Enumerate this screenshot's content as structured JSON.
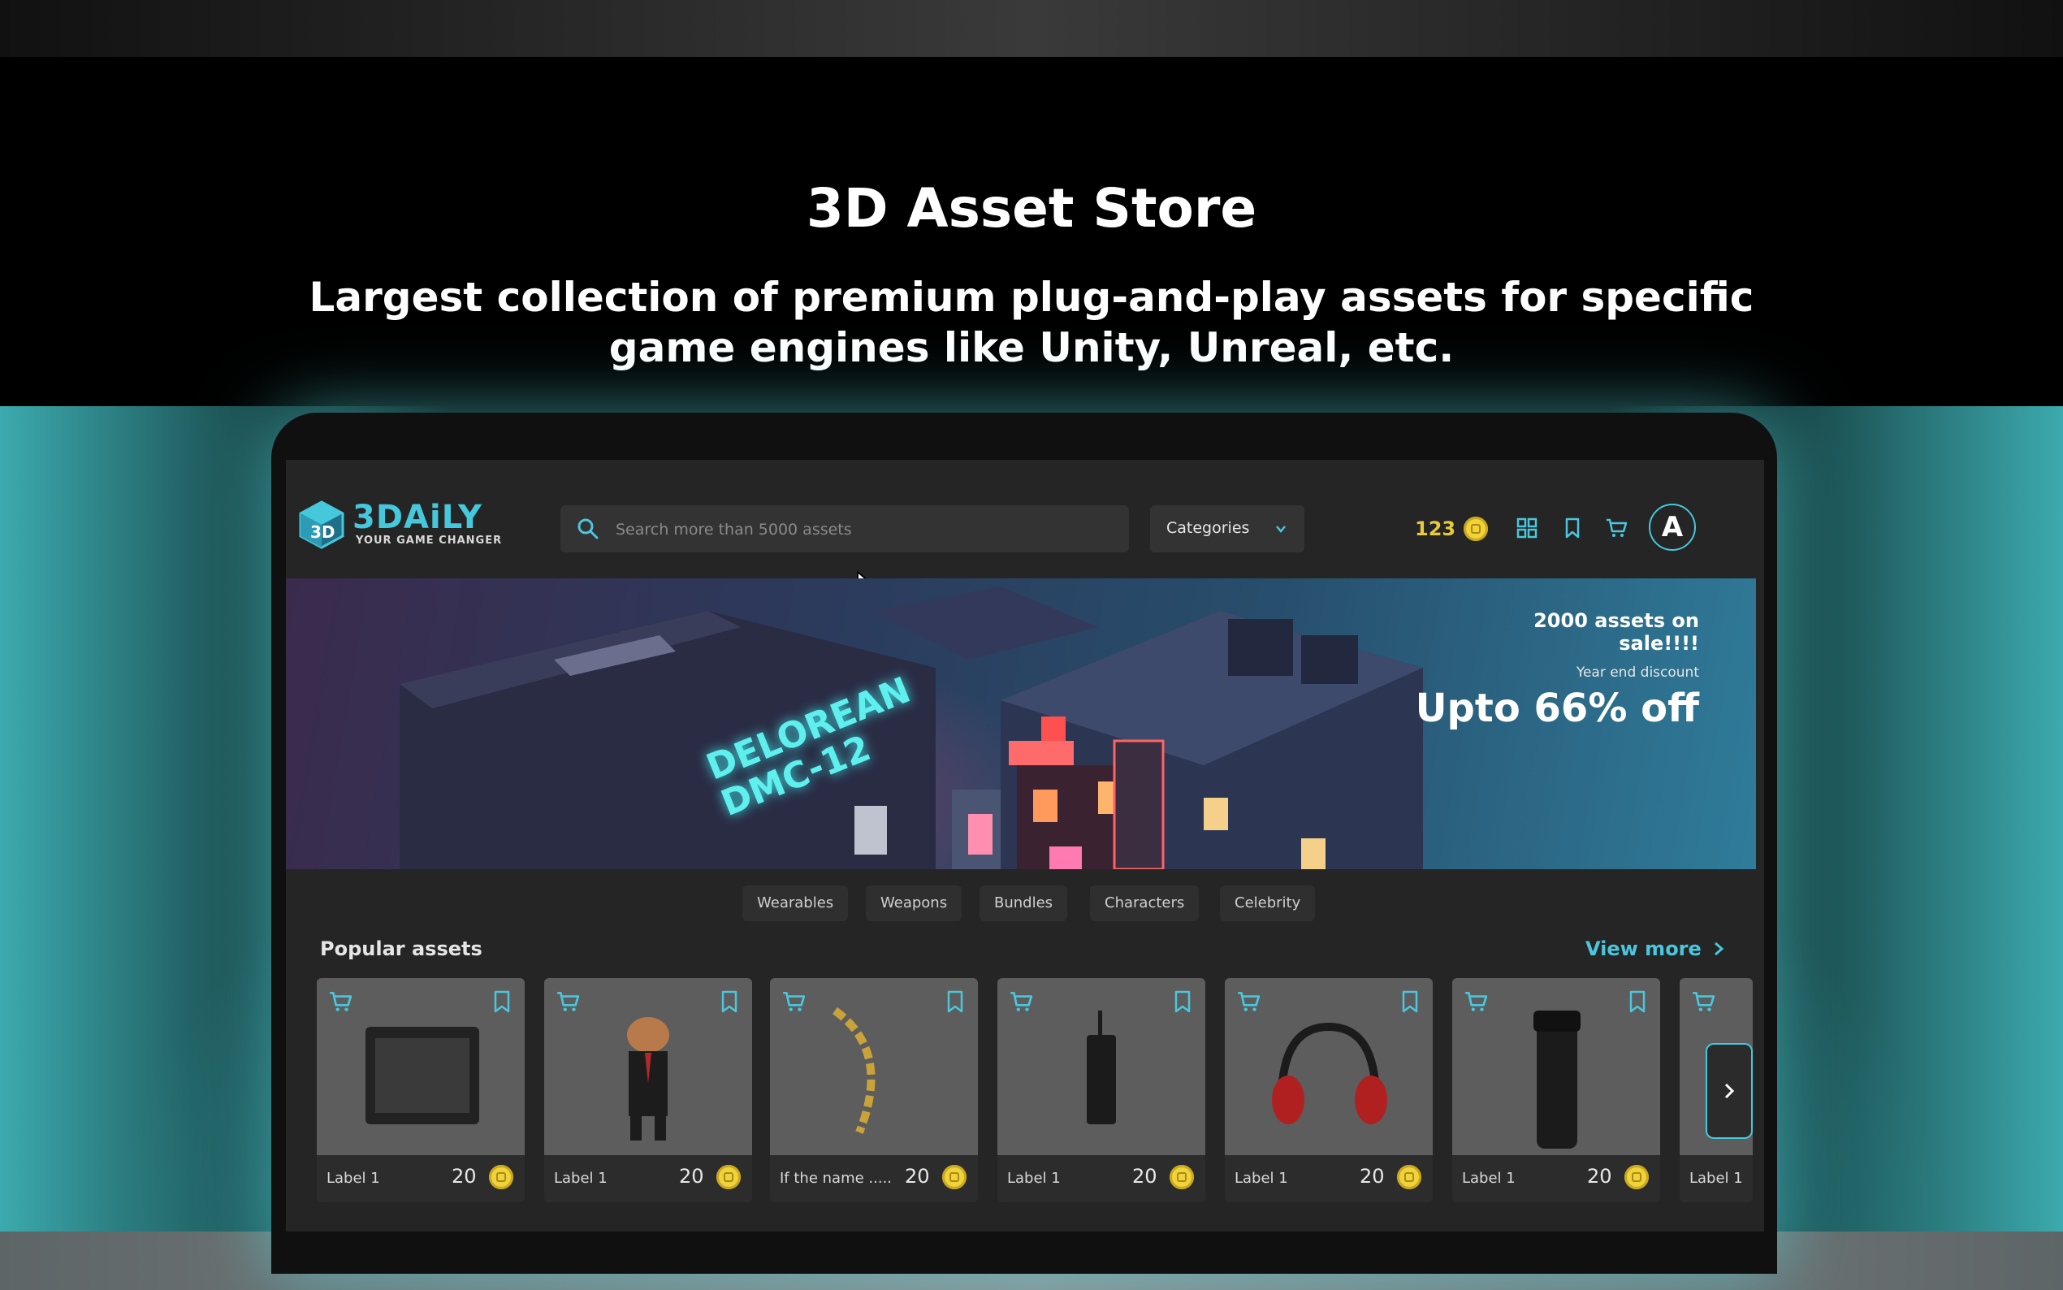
{
  "hero": {
    "title": "3D Asset Store",
    "subtitle": "Largest collection of premium plug-and-play assets for specific game engines like Unity, Unreal, etc."
  },
  "header": {
    "logo_text": "3DAiLY",
    "logo_tagline": "YOUR GAME CHANGER",
    "search_placeholder": "Search more than 5000 assets",
    "categories_label": "Categories",
    "coin_count": "123",
    "avatar_letter": "A"
  },
  "banner": {
    "sale_text": "2000 assets on sale!!!!",
    "subtext": "Year end discount",
    "discount_text": "Upto 66% off",
    "neon_sign": "DELOREAN\nDMC-12"
  },
  "chips": [
    "Wearables",
    "Weapons",
    "Bundles",
    "Characters",
    "Celebrity"
  ],
  "popular": {
    "title": "Popular assets",
    "view_more": "View more",
    "cards": [
      {
        "label": "Label 1",
        "price": "20"
      },
      {
        "label": "Label 1",
        "price": "20"
      },
      {
        "label": "If the name .....",
        "price": "20"
      },
      {
        "label": "Label 1",
        "price": "20"
      },
      {
        "label": "Label 1",
        "price": "20"
      },
      {
        "label": "Label 1",
        "price": "20"
      },
      {
        "label": "Label 1",
        "price": ""
      }
    ]
  },
  "colors": {
    "accent": "#45c8dc",
    "coin": "#f0d23a",
    "glow": "#50d2d7"
  }
}
